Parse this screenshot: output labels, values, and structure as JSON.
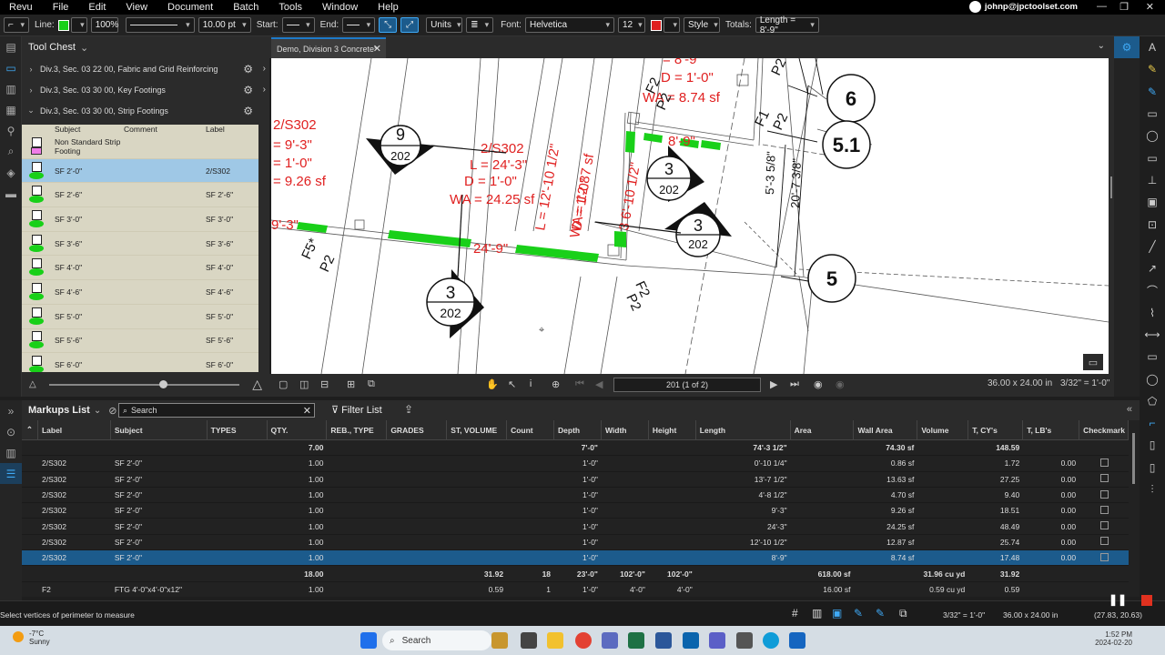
{
  "menu": [
    "Revu",
    "File",
    "Edit",
    "View",
    "Document",
    "Batch",
    "Tools",
    "Window",
    "Help"
  ],
  "account": "johnp@jpctoolset.com",
  "toolbar": {
    "line_label": "Line:",
    "zoom": "100%",
    "line_width": "10.00 pt",
    "start_label": "Start:",
    "end_label": "End:",
    "units_label": "Units",
    "font_label": "Font:",
    "font_value": "Helvetica",
    "font_size": "12",
    "style_label": "Style",
    "totals_label": "Totals:",
    "totals_value": "Length = 8'-9\"",
    "line_color": "#19d019",
    "text_color": "#e02020"
  },
  "tool_chest": {
    "title": "Tool Chest",
    "sections": [
      {
        "label": "Div.3, Sec. 03 22 00, Fabric and Grid Reinforcing",
        "expanded": false
      },
      {
        "label": "Div.3, Sec. 03 30 00, Key Footings",
        "expanded": false
      },
      {
        "label": "Div.3, Sec. 03 30 00, Strip Footings",
        "expanded": true
      }
    ],
    "columns": [
      "Subject",
      "Comment",
      "Label"
    ],
    "rows": [
      {
        "subject": "Non Standard Strip Footing",
        "comment": "",
        "label": "",
        "icon": "pink"
      },
      {
        "subject": "SF 2'-0\"",
        "comment": "",
        "label": "2/S302",
        "selected": true
      },
      {
        "subject": "SF 2'-6\"",
        "comment": "",
        "label": "SF 2'-6\""
      },
      {
        "subject": "SF 3'-0\"",
        "comment": "",
        "label": "SF 3'-0\""
      },
      {
        "subject": "SF 3'-6\"",
        "comment": "",
        "label": "SF 3'-6\""
      },
      {
        "subject": "SF 4'-0\"",
        "comment": "",
        "label": "SF 4'-0\""
      },
      {
        "subject": "SF 4'-6\"",
        "comment": "",
        "label": "SF 4'-6\""
      },
      {
        "subject": "SF 5'-0\"",
        "comment": "",
        "label": "SF 5'-0\""
      },
      {
        "subject": "SF 5'-6\"",
        "comment": "",
        "label": "SF 5'-6\""
      },
      {
        "subject": "SF 6'-0\"",
        "comment": "",
        "label": "SF 6'-0\""
      }
    ]
  },
  "document": {
    "tab": "Demo, Division 3 Concrete*",
    "page": "201 (1 of 2)",
    "size": "36.00 x 24.00 in",
    "scale": "3/32\" = 1'-0\""
  },
  "drawing": {
    "red_text": [
      "2/S302",
      "= 9'-3\"",
      "= 1'-0\"",
      "= 9.26 sf",
      "2/S302",
      "L = 24'-3\"",
      "D = 1'-0\"",
      "WA = 24.25 sf",
      "L = 12'-10 1/2\"",
      "D = 1'-0\"",
      "WA = 12.87 sf",
      "3 6'-10 1/2\"",
      "= 8'-9\"",
      "D = 1'-0\"",
      "WA = 8.74 sf",
      "8'-9\"",
      "24'-9\"",
      "9'-3\""
    ],
    "black_labels": [
      "F5*",
      "P2",
      "F2",
      "P2",
      "F1",
      "P2",
      "F2",
      "P2",
      "P2"
    ],
    "dims": [
      "5'-3 5/8\"",
      "20'-7 3/8\""
    ],
    "grid_bubbles": [
      "6",
      "5.1",
      "5"
    ],
    "section_markers": [
      {
        "top": "9",
        "bottom": "202"
      },
      {
        "top": "3",
        "bottom": "202"
      },
      {
        "top": "3",
        "bottom": "202"
      },
      {
        "top": "3",
        "bottom": "202"
      }
    ]
  },
  "markups": {
    "title": "Markups List",
    "search_placeholder": "Search",
    "filter_label": "Filter List",
    "columns": [
      "Label",
      "Subject",
      "TYPES",
      "QTY.",
      "REB., TYPE",
      "GRADES",
      "ST, VOLUME",
      "Count",
      "Depth",
      "Width",
      "Height",
      "Length",
      "Area",
      "Wall Area",
      "Volume",
      "T, CY's",
      "T, LB's",
      "Checkmark"
    ],
    "rows": [
      {
        "kind": "group",
        "cells": [
          "",
          "",
          "",
          "7.00",
          "",
          "",
          "",
          "",
          "7'-0\"",
          "",
          "",
          "74'-3 1/2\"",
          "",
          "74.30 sf",
          "",
          "148.59",
          "",
          ""
        ]
      },
      {
        "kind": "row",
        "cells": [
          "2/S302",
          "SF 2'-0\"",
          "",
          "1.00",
          "",
          "",
          "",
          "",
          "1'-0\"",
          "",
          "",
          "0'-10 1/4\"",
          "",
          "0.86 sf",
          "",
          "1.72",
          "0.00",
          "cb"
        ]
      },
      {
        "kind": "row",
        "cells": [
          "2/S302",
          "SF 2'-0\"",
          "",
          "1.00",
          "",
          "",
          "",
          "",
          "1'-0\"",
          "",
          "",
          "13'-7 1/2\"",
          "",
          "13.63 sf",
          "",
          "27.25",
          "0.00",
          "cb"
        ]
      },
      {
        "kind": "row",
        "cells": [
          "2/S302",
          "SF 2'-0\"",
          "",
          "1.00",
          "",
          "",
          "",
          "",
          "1'-0\"",
          "",
          "",
          "4'-8 1/2\"",
          "",
          "4.70 sf",
          "",
          "9.40",
          "0.00",
          "cb"
        ]
      },
      {
        "kind": "row",
        "cells": [
          "2/S302",
          "SF 2'-0\"",
          "",
          "1.00",
          "",
          "",
          "",
          "",
          "1'-0\"",
          "",
          "",
          "9'-3\"",
          "",
          "9.26 sf",
          "",
          "18.51",
          "0.00",
          "cb"
        ]
      },
      {
        "kind": "row",
        "cells": [
          "2/S302",
          "SF 2'-0\"",
          "",
          "1.00",
          "",
          "",
          "",
          "",
          "1'-0\"",
          "",
          "",
          "24'-3\"",
          "",
          "24.25 sf",
          "",
          "48.49",
          "0.00",
          "cb"
        ]
      },
      {
        "kind": "row",
        "cells": [
          "2/S302",
          "SF 2'-0\"",
          "",
          "1.00",
          "",
          "",
          "",
          "",
          "1'-0\"",
          "",
          "",
          "12'-10 1/2\"",
          "",
          "12.87 sf",
          "",
          "25.74",
          "0.00",
          "cb"
        ]
      },
      {
        "kind": "sel",
        "cells": [
          "2/S302",
          "SF 2'-0\"",
          "",
          "1.00",
          "",
          "",
          "",
          "",
          "1'-0\"",
          "",
          "",
          "8'-9\"",
          "",
          "8.74 sf",
          "",
          "17.48",
          "0.00",
          "cb"
        ]
      },
      {
        "kind": "group",
        "cells": [
          "",
          "",
          "",
          "18.00",
          "",
          "",
          "31.92",
          "18",
          "23'-0\"",
          "102'-0\"",
          "102'-0\"",
          "",
          "618.00 sf",
          "",
          "31.96 cu yd",
          "31.92",
          "",
          ""
        ]
      },
      {
        "kind": "row",
        "cells": [
          "F2",
          "FTG 4'-0\"x4'-0\"x12\"",
          "",
          "1.00",
          "",
          "",
          "0.59",
          "1",
          "1'-0\"",
          "4'-0\"",
          "4'-0\"",
          "",
          "16.00 sf",
          "",
          "0.59 cu yd",
          "0.59",
          "",
          ""
        ]
      }
    ]
  },
  "status": {
    "hint": "Select vertices of perimeter to measure",
    "scale": "3/32\" = 1'-0\"",
    "size": "36.00 x 24.00 in",
    "coords": "(27.83, 20.63)"
  },
  "taskbar": {
    "temp": "-7°C",
    "weather": "Sunny",
    "search": "Search",
    "time": "1:52 PM",
    "date": "2024-02-20"
  }
}
